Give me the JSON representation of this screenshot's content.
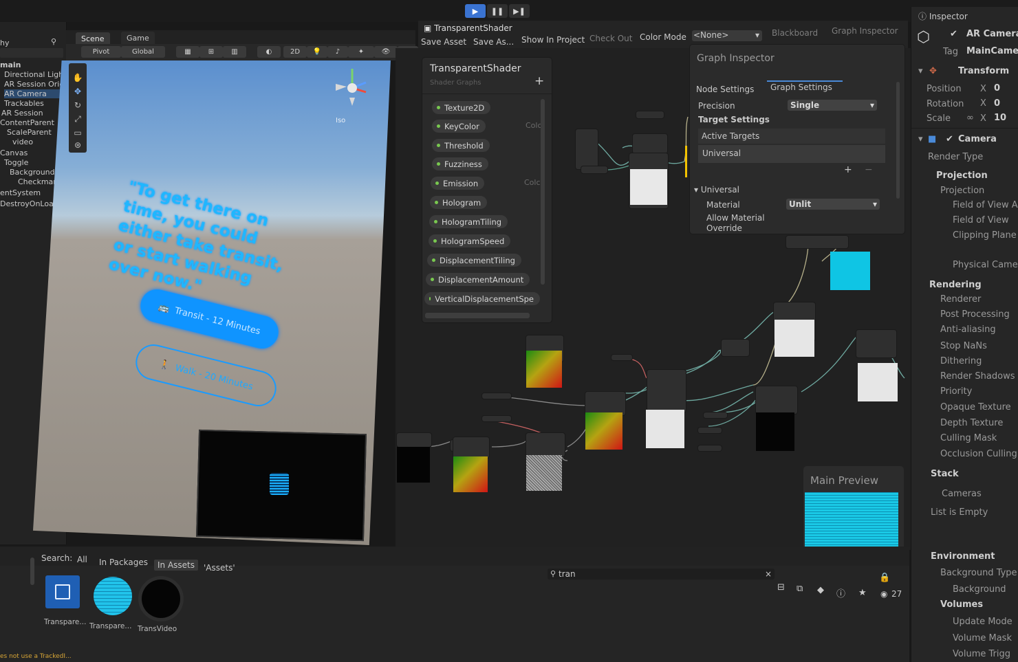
{
  "toolbar": {
    "play": "▶",
    "pause": "❚❚",
    "step": "▶❚"
  },
  "hierarchy": {
    "title": "hy",
    "items": [
      "main",
      "Directional Light",
      "AR Session Origin",
      "AR Camera",
      "Trackables",
      "AR Session",
      "ContentParent",
      "ScaleParent",
      "video",
      "Canvas",
      "Toggle",
      "Background",
      "Checkmark",
      "entSystem",
      "DestroyOnLoa"
    ]
  },
  "scene": {
    "tabs": [
      "Scene",
      "Game"
    ],
    "toolbar": {
      "pivot": "Pivot",
      "global": "Global",
      "mode_2d": "2D"
    },
    "gizmo_label": "Iso",
    "quote": "\"To get there on time, you could either take transit, or start walking over now.\"",
    "btn_transit": "Transit - 12 Minutes",
    "btn_walk": "Walk - 20 Minutes"
  },
  "shader_graph": {
    "tab_title": "TransparentShader",
    "save_asset": "Save Asset",
    "save_as": "Save As...",
    "show_in_project": "Show In Project",
    "check_out": "Check Out",
    "color_mode": "Color Mode",
    "color_mode_value": "<None>",
    "blackboard_btn": "Blackboard",
    "graph_inspector_btn": "Graph Inspector",
    "blackboard": {
      "title": "TransparentShader",
      "subtitle": "Shader Graphs",
      "add": "+",
      "properties": [
        "Texture2D",
        "KeyColor",
        "Threshold",
        "Fuzziness",
        "Emission",
        "Hologram",
        "HologramTiling",
        "HologramSpeed",
        "DisplacementTiling",
        "DisplacementAmount",
        "VerticalDisplacementSpe"
      ],
      "col_hint_1": "Colc",
      "col_hint_2": "Colc"
    },
    "inspector": {
      "title": "Graph Inspector",
      "tab_node": "Node Settings",
      "tab_graph": "Graph Settings",
      "precision_label": "Precision",
      "precision_value": "Single",
      "target_settings": "Target Settings",
      "active_targets": "Active Targets",
      "active_target_item": "Universal",
      "universal_section": "Universal",
      "material_label": "Material",
      "material_value": "Unlit",
      "allow_override": "Allow Material Override"
    },
    "main_preview": "Main Preview"
  },
  "inspector": {
    "tab": "Inspector",
    "object_name": "AR Camera",
    "tag_label": "Tag",
    "tag_value": "MainCamera",
    "transform": "Transform",
    "position": "Position",
    "rotation": "Rotation",
    "scale": "Scale",
    "axis_x": "X",
    "pos_x": "0",
    "rot_x": "0",
    "scale_x": "10",
    "camera": "Camera",
    "rows": [
      "Render Type",
      "Projection",
      "Projection",
      "Field of View A",
      "Field of View",
      "Clipping Plane",
      "Physical Came",
      "Rendering",
      "Renderer",
      "Post Processing",
      "Anti-aliasing",
      "Stop NaNs",
      "Dithering",
      "Render Shadows",
      "Priority",
      "Opaque Texture",
      "Depth Texture",
      "Culling Mask",
      "Occlusion Culling",
      "Stack",
      "Cameras",
      "List is Empty",
      "Environment",
      "Background Type",
      "Background",
      "Volumes",
      "Update Mode",
      "Volume Mask",
      "Volume Trigg"
    ]
  },
  "project": {
    "search_label": "Search:",
    "filter_all": "All",
    "filter_packages": "In Packages",
    "filter_assets": "In Assets",
    "filter_assets_folder": "'Assets'",
    "search_value": "tran",
    "count": "27",
    "assets": [
      "Transpare...",
      "Transpare...",
      "TransVideo"
    ]
  },
  "status": {
    "message": "es not use a TrackedI..."
  }
}
